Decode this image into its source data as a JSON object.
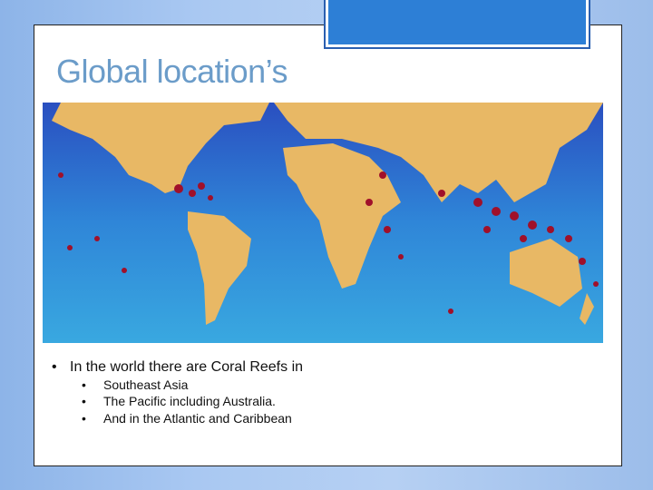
{
  "slide": {
    "title": "Global location’s",
    "map": {
      "image": "world-coral-reef-map",
      "ocean_color": "#2f7fd0",
      "land_color": "#e8b865",
      "reef_color": "#a0102a"
    },
    "bullet": "In the world there are Coral Reefs in",
    "sub_bullets": [
      "Southeast Asia",
      "The Pacific including Australia.",
      "And in the Atlantic and Caribbean"
    ],
    "bullet_symbol": "•"
  }
}
